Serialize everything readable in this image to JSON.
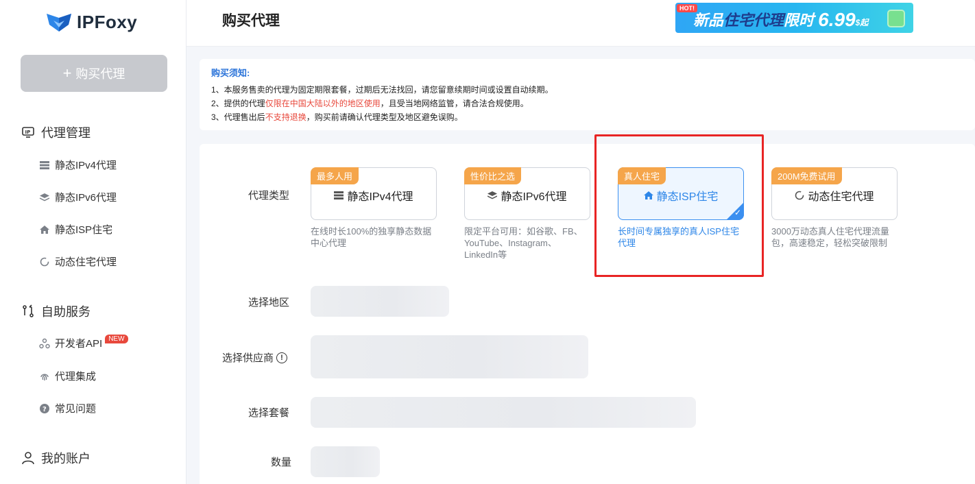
{
  "sidebar": {
    "logo_text": "IPFoxy",
    "buy_button": "购买代理",
    "sections": {
      "proxy_mgmt": "代理管理",
      "self_service": "自助服务",
      "account": "我的账户"
    },
    "items": {
      "ipv4": "静态IPv4代理",
      "ipv6": "静态IPv6代理",
      "isp": "静态ISP住宅",
      "dynamic": "动态住宅代理",
      "api": "开发者API",
      "api_badge": "NEW",
      "integration": "代理集成",
      "faq": "常见问题"
    }
  },
  "header": {
    "title": "购买代理",
    "promo": {
      "hot": "HOT!",
      "text1": "新品",
      "text2": "住宅代理",
      "text3": "限时",
      "price": "6.99",
      "unit": "$起"
    }
  },
  "notice": {
    "title": "购买须知:",
    "line1": "1、本服务售卖的代理为固定期限套餐，过期后无法找回，请您留意续期时间或设置自动续期。",
    "line2_a": "2、提供的代理",
    "line2_red": "仅限在中国大陆以外的地区使用",
    "line2_b": "，且受当地网络监管，请合法合规使用。",
    "line3_a": "3、代理售出后",
    "line3_red": "不支持退换",
    "line3_b": "，购买前请确认代理类型及地区避免误购。"
  },
  "form": {
    "label_type": "代理类型",
    "label_region": "选择地区",
    "label_provider": "选择供应商",
    "label_package": "选择套餐",
    "label_quantity": "数量",
    "types": [
      {
        "tag": "最多人用",
        "name": "静态IPv4代理",
        "desc": "在线时长100%的独享静态数据中心代理"
      },
      {
        "tag": "性价比之选",
        "name": "静态IPv6代理",
        "desc": "限定平台可用：如谷歌、FB、YouTube、Instagram、LinkedIn等"
      },
      {
        "tag": "真人住宅",
        "name": "静态ISP住宅",
        "desc": "长时间专属独享的真人ISP住宅代理"
      },
      {
        "tag": "200M免费试用",
        "name": "动态住宅代理",
        "desc": "3000万动态真人住宅代理流量包，高速稳定，轻松突破限制"
      }
    ]
  },
  "colors": {
    "accent": "#2d86e8",
    "tag": "#f5a54a",
    "highlight": "#e82424",
    "notice_red": "#e8483c"
  }
}
